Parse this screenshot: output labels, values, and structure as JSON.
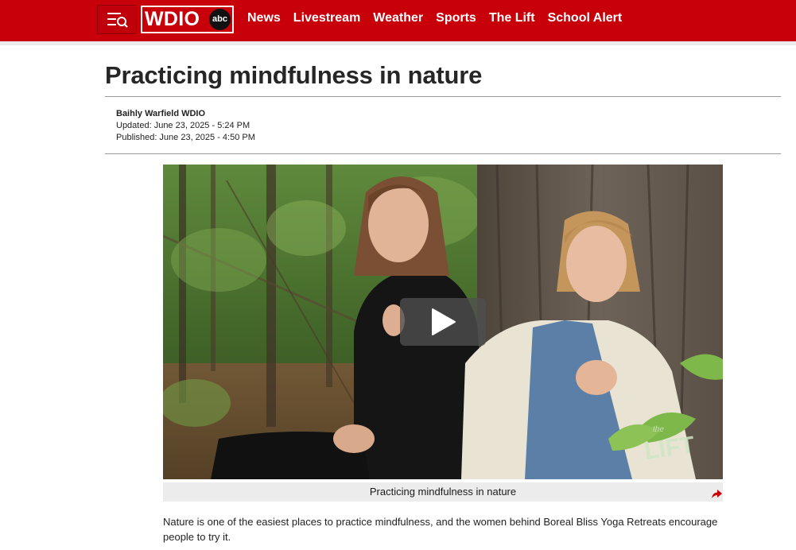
{
  "header": {
    "logo": {
      "text": "WDIO",
      "network": "abc"
    },
    "nav": [
      "News",
      "Livestream",
      "Weather",
      "Sports",
      "The Lift",
      "School Alert"
    ],
    "brand_color": "#c8000a"
  },
  "article": {
    "headline": "Practicing mindfulness in nature",
    "author": "Baihly Warfield WDIO",
    "updated": "Updated: June 23, 2025 - 5:24 PM",
    "published": "Published: June 23, 2025 - 4:50 PM",
    "video": {
      "caption": "Practicing mindfulness in nature",
      "watermark": "the LIFT",
      "icons": [
        "play-icon",
        "share-icon"
      ]
    },
    "body": "Nature is one of the easiest places to practice mindfulness, and the women behind Boreal Bliss Yoga Retreats encourage people to try it."
  }
}
